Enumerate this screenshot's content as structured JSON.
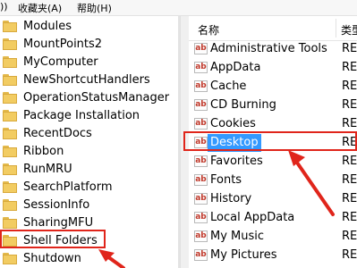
{
  "menubar": {
    "items": [
      {
        "label": "))"
      },
      {
        "label": "收藏夹(A)"
      },
      {
        "label": "帮助(H)"
      }
    ]
  },
  "tree": {
    "items": [
      {
        "label": "Modules"
      },
      {
        "label": "MountPoints2"
      },
      {
        "label": "MyComputer"
      },
      {
        "label": "NewShortcutHandlers"
      },
      {
        "label": "OperationStatusManager"
      },
      {
        "label": "Package Installation"
      },
      {
        "label": "RecentDocs"
      },
      {
        "label": "Ribbon"
      },
      {
        "label": "RunMRU"
      },
      {
        "label": "SearchPlatform"
      },
      {
        "label": "SessionInfo"
      },
      {
        "label": "SharingMFU"
      },
      {
        "label": "Shell Folders"
      },
      {
        "label": "Shutdown"
      }
    ]
  },
  "list": {
    "header": {
      "name": "名称",
      "type": "类型"
    },
    "icon_text": "ab",
    "rows": [
      {
        "label": "Administrative Tools",
        "type": "REG"
      },
      {
        "label": "AppData",
        "type": "REG"
      },
      {
        "label": "Cache",
        "type": "REG"
      },
      {
        "label": "CD Burning",
        "type": "REG"
      },
      {
        "label": "Cookies",
        "type": "REG"
      },
      {
        "label": "Desktop",
        "type": "REG"
      },
      {
        "label": "Favorites",
        "type": "REG"
      },
      {
        "label": "Fonts",
        "type": "REG"
      },
      {
        "label": "History",
        "type": "REG"
      },
      {
        "label": "Local AppData",
        "type": "REG"
      },
      {
        "label": "My Music",
        "type": "REG"
      },
      {
        "label": "My Pictures",
        "type": "REG"
      }
    ]
  },
  "colors": {
    "highlight": "#e0251b",
    "selection": "#3399ff",
    "folder": "#f2cc62"
  }
}
